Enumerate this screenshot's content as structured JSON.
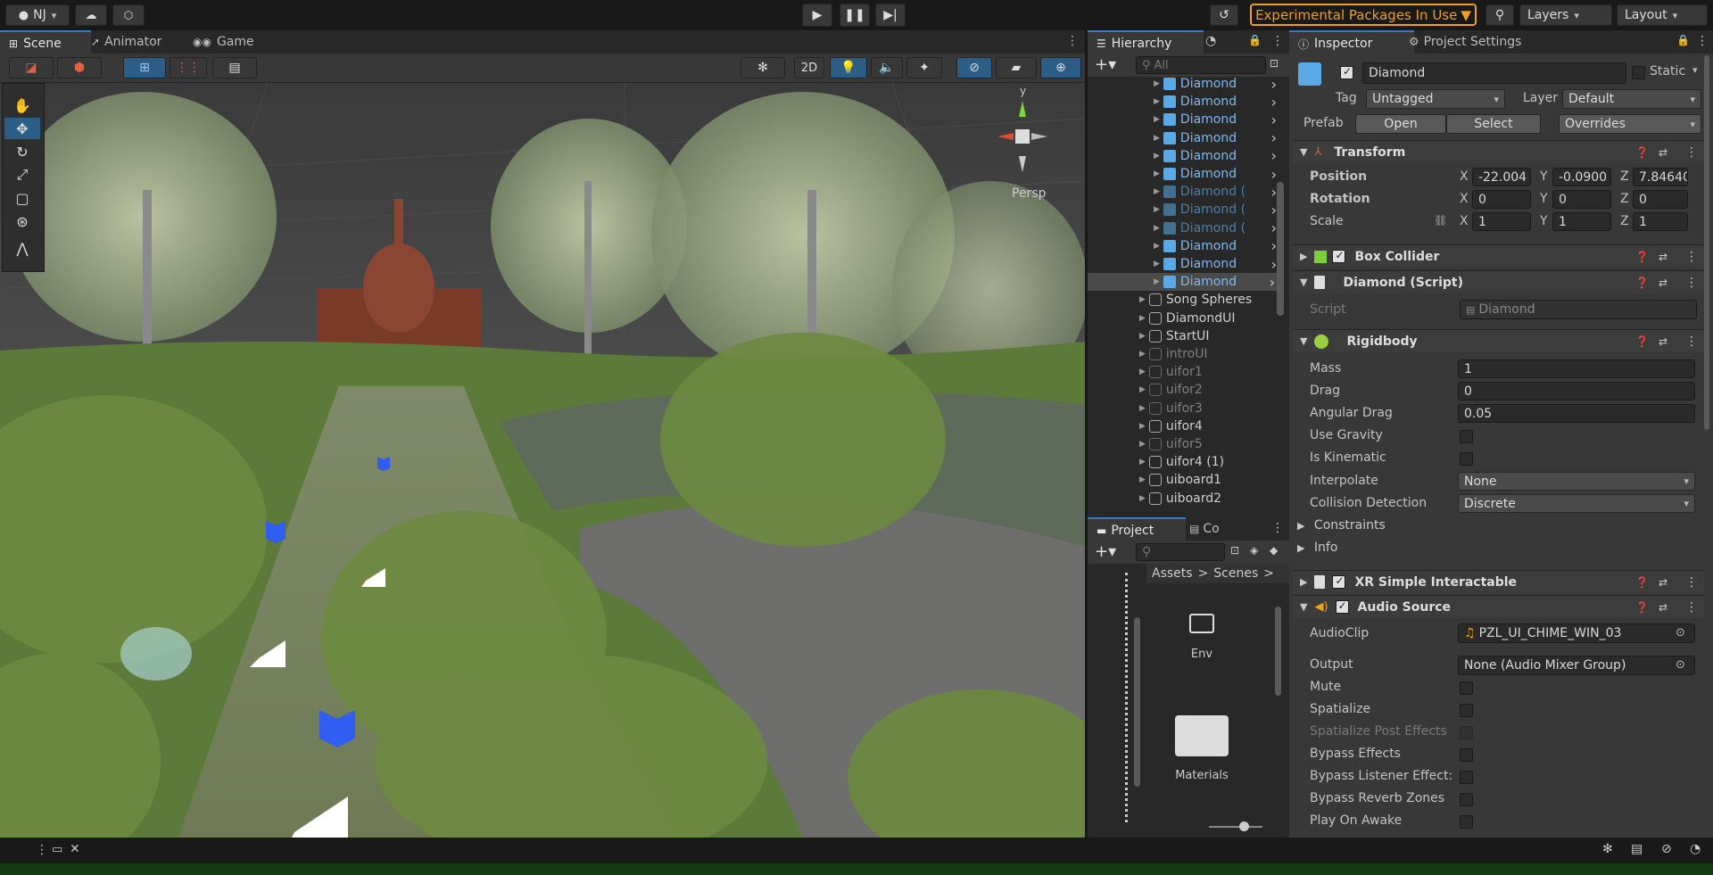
{
  "topbar": {
    "account": "NJ",
    "experimental": "Experimental Packages In Use",
    "layers": "Layers",
    "layout": "Layout"
  },
  "scene": {
    "tabs": [
      "Scene",
      "Animator",
      "Game"
    ],
    "toggle_2d": "2D",
    "persp": "Persp",
    "gizmo_axis": "y"
  },
  "hierarchy": {
    "tab": "Hierarchy",
    "search_placeholder": "All",
    "items": [
      {
        "label": "Diamond",
        "style": "blue"
      },
      {
        "label": "Diamond",
        "style": "blue"
      },
      {
        "label": "Diamond",
        "style": "blue"
      },
      {
        "label": "Diamond",
        "style": "blue"
      },
      {
        "label": "Diamond",
        "style": "blue"
      },
      {
        "label": "Diamond",
        "style": "blue"
      },
      {
        "label": "Diamond (",
        "style": "blue-dim"
      },
      {
        "label": "Diamond (",
        "style": "blue-dim"
      },
      {
        "label": "Diamond (",
        "style": "blue-dim"
      },
      {
        "label": "Diamond",
        "style": "blue"
      },
      {
        "label": "Diamond",
        "style": "blue"
      },
      {
        "label": "Diamond",
        "style": "blue"
      },
      {
        "label": "Song Spheres",
        "style": "normal"
      },
      {
        "label": "DiamondUI",
        "style": "normal"
      },
      {
        "label": "StartUI",
        "style": "normal"
      },
      {
        "label": "introUI",
        "style": "dim"
      },
      {
        "label": "uifor1",
        "style": "dim"
      },
      {
        "label": "uifor2",
        "style": "dim"
      },
      {
        "label": "uifor3",
        "style": "dim"
      },
      {
        "label": "uifor4",
        "style": "normal"
      },
      {
        "label": "uifor5",
        "style": "dim"
      },
      {
        "label": "uifor4 (1)",
        "style": "normal"
      },
      {
        "label": "uiboard1",
        "style": "normal"
      },
      {
        "label": "uiboard2",
        "style": "normal"
      }
    ]
  },
  "project": {
    "tab_project": "Project",
    "tab_console": "Co",
    "breadcrumb": [
      "Assets",
      "Scenes"
    ],
    "folders": [
      "Env",
      "Materials"
    ]
  },
  "inspector": {
    "tab": "Inspector",
    "tab_settings": "Project Settings",
    "object_name": "Diamond",
    "static_label": "Static",
    "tag_label": "Tag",
    "tag_value": "Untagged",
    "layer_label": "Layer",
    "layer_value": "Default",
    "prefab_label": "Prefab",
    "open": "Open",
    "select": "Select",
    "overrides": "Overrides",
    "transform": {
      "title": "Transform",
      "position_label": "Position",
      "rotation_label": "Rotation",
      "scale_label": "Scale",
      "position": [
        "-22.004",
        "-0.0900",
        "7.84640"
      ],
      "rotation": [
        "0",
        "0",
        "0"
      ],
      "scale": [
        "1",
        "1",
        "1"
      ],
      "axis": [
        "X",
        "Y",
        "Z"
      ]
    },
    "box_collider": "Box Collider",
    "diamond_script": {
      "title": "Diamond (Script)",
      "script_label": "Script",
      "script_value": "Diamond"
    },
    "rigidbody": {
      "title": "Rigidbody",
      "mass_label": "Mass",
      "mass": "1",
      "drag_label": "Drag",
      "drag": "0",
      "angular_label": "Angular Drag",
      "angular": "0.05",
      "gravity_label": "Use Gravity",
      "kinematic_label": "Is Kinematic",
      "interpolate_label": "Interpolate",
      "interpolate": "None",
      "collision_label": "Collision Detection",
      "collision": "Discrete",
      "constraints_label": "Constraints",
      "info_label": "Info"
    },
    "xr": "XR Simple Interactable",
    "audio": {
      "title": "Audio Source",
      "clip_label": "AudioClip",
      "clip": "PZL_UI_CHIME_WIN_03",
      "output_label": "Output",
      "output": "None (Audio Mixer Group)",
      "mute": "Mute",
      "spatialize": "Spatialize",
      "spatialize_post": "Spatialize Post Effects",
      "bypass_effects": "Bypass Effects",
      "bypass_listener": "Bypass Listener Effect:",
      "bypass_reverb": "Bypass Reverb Zones",
      "play_on_awake": "Play On Awake"
    }
  },
  "colors": {
    "accent": "#3a79bb",
    "warning": "#f0a020",
    "panel": "#383838",
    "bg": "#191919"
  }
}
